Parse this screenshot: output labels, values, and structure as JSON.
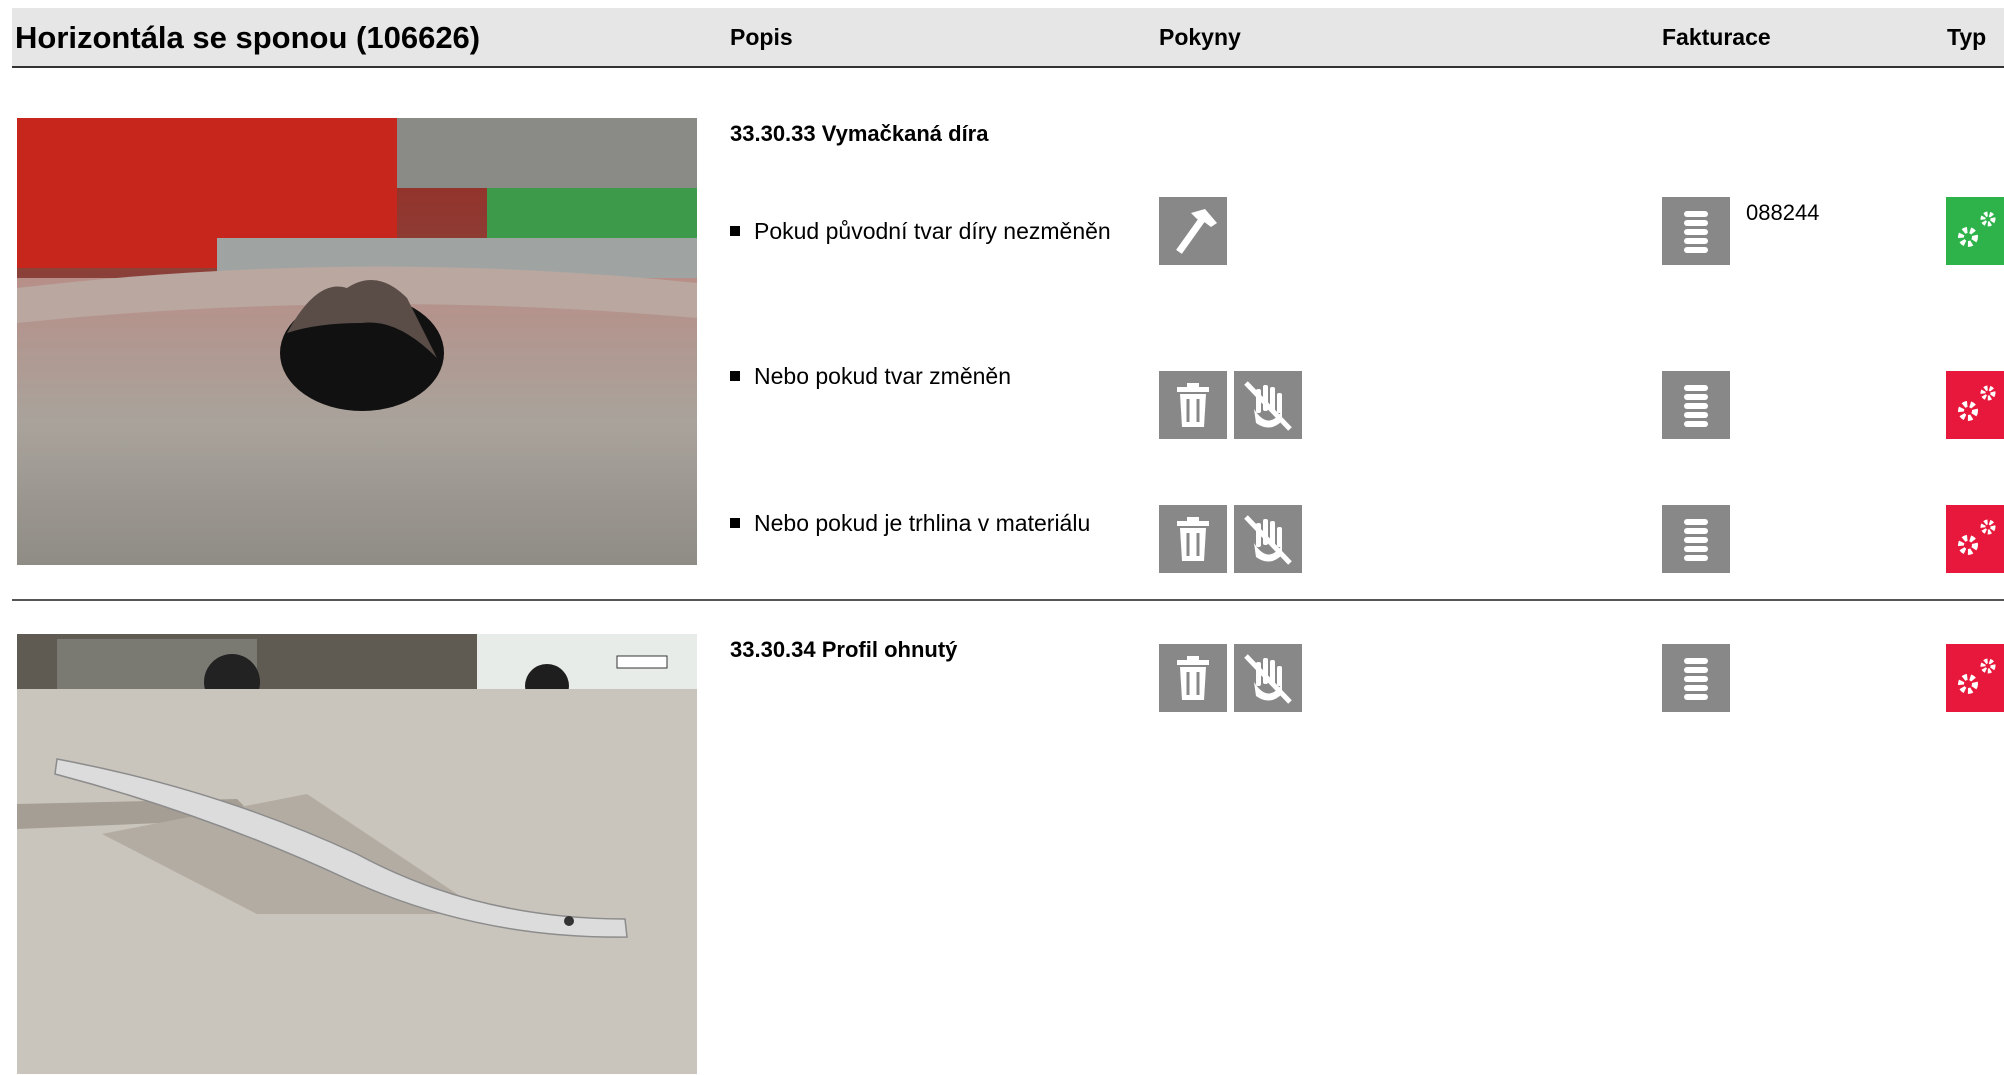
{
  "header": {
    "title": "Horizontála se sponou (106626)",
    "columns": {
      "popis": "Popis",
      "pokyny": "Pokyny",
      "fakturace": "Fakturace",
      "typ": "Typ"
    }
  },
  "sections": [
    {
      "heading": "33.30.33 Vymačkaná díra",
      "photo": "pressed-hole-photo",
      "rows": [
        {
          "text": "Pokud původní tvar díry nezměněn",
          "instructions": [
            "hammer-icon"
          ],
          "billing_icon": "coins-icon",
          "billing_code": "088244",
          "type_color": "#2db34a",
          "type_icon": "gears-icon"
        },
        {
          "text": "Nebo pokud tvar změněn",
          "instructions": [
            "trash-icon",
            "no-hand-icon"
          ],
          "billing_icon": "coins-icon",
          "billing_code": "",
          "type_color": "#e8183c",
          "type_icon": "gears-icon"
        },
        {
          "text": "Nebo pokud je trhlina v materiálu",
          "instructions": [
            "trash-icon",
            "no-hand-icon"
          ],
          "billing_icon": "coins-icon",
          "billing_code": "",
          "type_color": "#e8183c",
          "type_icon": "gears-icon"
        }
      ]
    },
    {
      "heading": "33.30.34 Profil ohnutý",
      "photo": "bent-profile-photo",
      "rows": [
        {
          "text": "",
          "instructions": [
            "trash-icon",
            "no-hand-icon"
          ],
          "billing_icon": "coins-icon",
          "billing_code": "",
          "type_color": "#e8183c",
          "type_icon": "gears-icon"
        }
      ]
    }
  ]
}
